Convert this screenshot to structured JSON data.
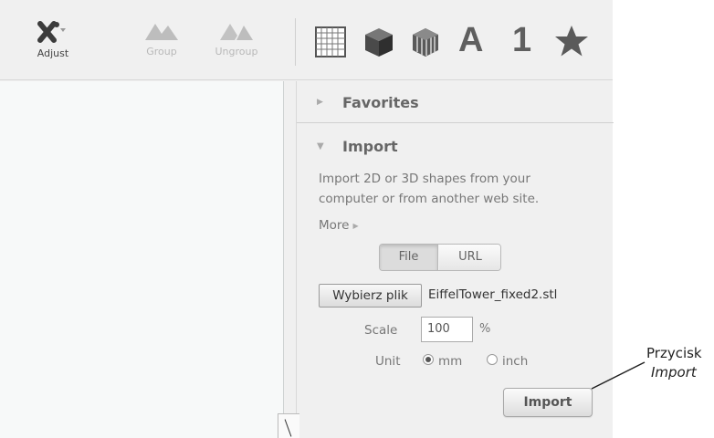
{
  "toolbar": {
    "adjust_label": "Adjust",
    "group_label": "Group",
    "ungroup_label": "Ungroup",
    "library_icons": [
      "grid-icon",
      "box-icon",
      "cylinder-icon",
      "letters-icon",
      "numbers-icon",
      "star-icon"
    ],
    "letters_glyph": "A",
    "numbers_glyph": "1"
  },
  "panel": {
    "favorites": {
      "label": "Favorites",
      "expanded": false
    },
    "import": {
      "label": "Import",
      "expanded": true,
      "description": "Import 2D or 3D shapes from your computer or from another web site.",
      "more_label": "More",
      "source_tabs": [
        "File",
        "URL"
      ],
      "selected_tab": "File",
      "choose_file_label": "Wybierz plik",
      "file_name": "EiffelTower_fixed2.stl",
      "scale_label": "Scale",
      "scale_value": "100",
      "scale_unit": "%",
      "unit_label": "Unit",
      "unit_options": [
        "mm",
        "inch"
      ],
      "selected_unit": "mm",
      "import_button": "Import"
    }
  },
  "annotation": {
    "line1": "Przycisk",
    "line2": "Import"
  },
  "colors": {
    "panel_bg": "#f0f0f0",
    "canvas_bg": "#f7f9f9",
    "icon_dark": "#5f5f5f",
    "icon_disabled": "#b8b8b8"
  }
}
